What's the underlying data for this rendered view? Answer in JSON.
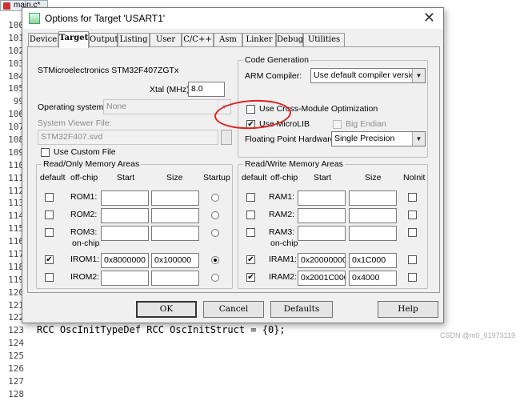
{
  "editor": {
    "tab_label": "main.c*",
    "line_numbers": [
      "100",
      "101",
      "102",
      "103",
      "104",
      "105",
      "99",
      "106",
      "107",
      "108",
      "109",
      "110",
      "111",
      "112",
      "113",
      "114",
      "115",
      "116",
      "117",
      "118",
      "119",
      "120",
      "121",
      "122",
      "123",
      "124",
      "125",
      "126",
      "127",
      "128"
    ],
    "code_line": "RCC OscInitTypeDef RCC OscInitStruct = {0};",
    "watermark": "CSDN @m0_61973119"
  },
  "dialog": {
    "title": "Options for Target 'USART1'",
    "close_glyph": "✕",
    "tabs": [
      "Device",
      "Target",
      "Output",
      "Listing",
      "User",
      "C/C++",
      "Asm",
      "Linker",
      "Debug",
      "Utilities"
    ],
    "active_tab": "Target",
    "device_name": "STMicroelectronics STM32F407ZGTx",
    "xtal_label": "Xtal (MHz):",
    "xtal_value": "8.0",
    "os_label": "Operating system:",
    "os_value": "None",
    "svd_label": "System Viewer File:",
    "svd_value": "STM32F407.svd",
    "custom_file_label": "Use Custom File",
    "codegen": {
      "title": "Code Generation",
      "arm_compiler_label": "ARM Compiler:",
      "arm_compiler_value": "Use default compiler version 5",
      "cross_module_label": "Use Cross-Module Optimization",
      "microlib_label": "Use MicroLIB",
      "microlib_checked": true,
      "big_endian_label": "Big Endian",
      "fp_label": "Floating Point Hardware:",
      "fp_value": "Single Precision"
    },
    "rom": {
      "title": "Read/Only Memory Areas",
      "headers": {
        "default": "default",
        "offchip": "off-chip",
        "start": "Start",
        "size": "Size",
        "startup": "Startup"
      },
      "onchip_label": "on-chip",
      "rows": [
        {
          "name": "ROM1:",
          "start": "",
          "size": "",
          "default": false,
          "startup": false
        },
        {
          "name": "ROM2:",
          "start": "",
          "size": "",
          "default": false,
          "startup": false
        },
        {
          "name": "ROM3:",
          "start": "",
          "size": "",
          "default": false,
          "startup": false
        },
        {
          "name": "IROM1:",
          "start": "0x8000000",
          "size": "0x100000",
          "default": true,
          "startup": true
        },
        {
          "name": "IROM2:",
          "start": "",
          "size": "",
          "default": false,
          "startup": false
        }
      ]
    },
    "ram": {
      "title": "Read/Write Memory Areas",
      "headers": {
        "default": "default",
        "offchip": "off-chip",
        "start": "Start",
        "size": "Size",
        "noinit": "NoInit"
      },
      "onchip_label": "on-chip",
      "rows": [
        {
          "name": "RAM1:",
          "start": "",
          "size": "",
          "default": false,
          "noinit": false
        },
        {
          "name": "RAM2:",
          "start": "",
          "size": "",
          "default": false,
          "noinit": false
        },
        {
          "name": "RAM3:",
          "start": "",
          "size": "",
          "default": false,
          "noinit": false
        },
        {
          "name": "IRAM1:",
          "start": "0x20000000",
          "size": "0x1C000",
          "default": true,
          "noinit": false
        },
        {
          "name": "IRAM2:",
          "start": "0x2001C000",
          "size": "0x4000",
          "default": true,
          "noinit": false
        }
      ]
    },
    "buttons": {
      "ok": "OK",
      "cancel": "Cancel",
      "defaults": "Defaults",
      "help": "Help"
    },
    "annotation_color": "#e02020"
  }
}
